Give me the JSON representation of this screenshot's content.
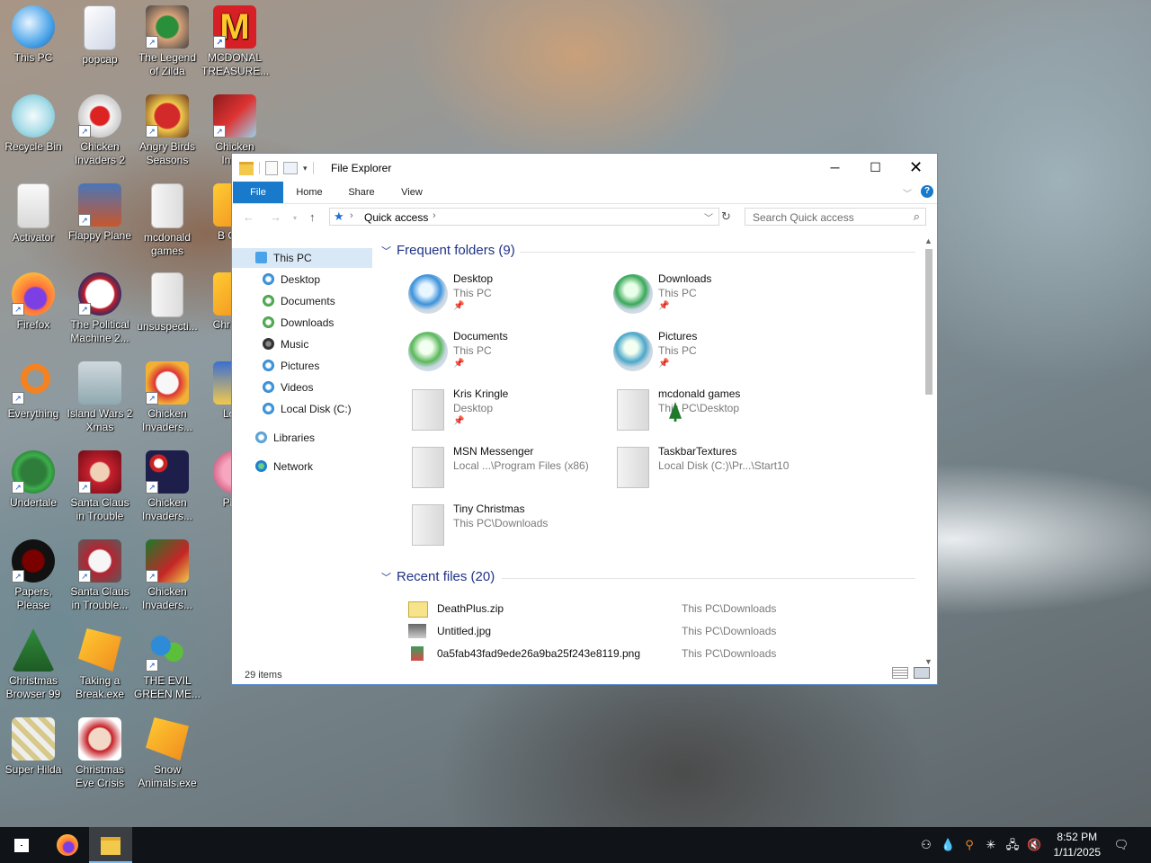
{
  "desktop": {
    "icons": [
      {
        "label": "This PC"
      },
      {
        "label": "popcap"
      },
      {
        "label": "The Legend of Zilda"
      },
      {
        "label": "MCDONAL TREASURE..."
      },
      {
        "label": "Recycle Bin"
      },
      {
        "label": "Chicken Invaders 2"
      },
      {
        "label": "Angry Birds Seasons"
      },
      {
        "label": "Chicken Invad"
      },
      {
        "label": "Activator"
      },
      {
        "label": "Flappy Plane"
      },
      {
        "label": "mcdonald games"
      },
      {
        "label": "B Orna"
      },
      {
        "label": "Firefox"
      },
      {
        "label": "The Political Machine 2..."
      },
      {
        "label": "unsuspecti..."
      },
      {
        "label": "Chri Swe"
      },
      {
        "label": "Everything"
      },
      {
        "label": "Island Wars 2 Xmas"
      },
      {
        "label": "Chicken Invaders..."
      },
      {
        "label": "Loca"
      },
      {
        "label": "Undertale"
      },
      {
        "label": "Santa Claus in Trouble"
      },
      {
        "label": "Chicken Invaders..."
      },
      {
        "label": "Piggi"
      },
      {
        "label": "Papers, Please"
      },
      {
        "label": "Santa Claus in Trouble..."
      },
      {
        "label": "Chicken Invaders..."
      },
      {
        "label": "Christmas Browser 99"
      },
      {
        "label": "Taking a Break.exe"
      },
      {
        "label": "THE EVIL GREEN ME..."
      },
      {
        "label": "Super Hilda"
      },
      {
        "label": "Christmas Eve Crisis"
      },
      {
        "label": "Snow Animals.exe"
      }
    ]
  },
  "window": {
    "title": "File Explorer",
    "tabs": {
      "file": "File",
      "home": "Home",
      "share": "Share",
      "view": "View"
    },
    "address": {
      "location": "Quick access"
    },
    "search": {
      "placeholder": "Search Quick access"
    },
    "nav": {
      "this_pc": "This PC",
      "desktop": "Desktop",
      "documents": "Documents",
      "downloads": "Downloads",
      "music": "Music",
      "pictures": "Pictures",
      "videos": "Videos",
      "local_disk": "Local Disk (C:)",
      "libraries": "Libraries",
      "network": "Network"
    },
    "frequent": {
      "header": "Frequent folders (9)",
      "items": [
        {
          "name": "Desktop",
          "loc": "This PC"
        },
        {
          "name": "Downloads",
          "loc": "This PC"
        },
        {
          "name": "Documents",
          "loc": "This PC"
        },
        {
          "name": "Pictures",
          "loc": "This PC"
        },
        {
          "name": "Kris Kringle",
          "loc": "Desktop"
        },
        {
          "name": "mcdonald games",
          "loc": "This PC\\Desktop"
        },
        {
          "name": "MSN Messenger",
          "loc": "Local ...\\Program Files (x86)"
        },
        {
          "name": "TaskbarTextures",
          "loc": "Local Disk (C:)\\Pr...\\Start10"
        },
        {
          "name": "Tiny Christmas",
          "loc": "This PC\\Downloads"
        }
      ]
    },
    "recent": {
      "header": "Recent files (20)",
      "items": [
        {
          "name": "DeathPlus.zip",
          "loc": "This PC\\Downloads"
        },
        {
          "name": "Untitled.jpg",
          "loc": "This PC\\Downloads"
        },
        {
          "name": "0a5fab43fad9ede26a9ba25f243e8119.png",
          "loc": "This PC\\Downloads"
        }
      ]
    },
    "status": "29 items"
  },
  "taskbar": {
    "time": "8:52 PM",
    "date": "1/11/2025"
  }
}
